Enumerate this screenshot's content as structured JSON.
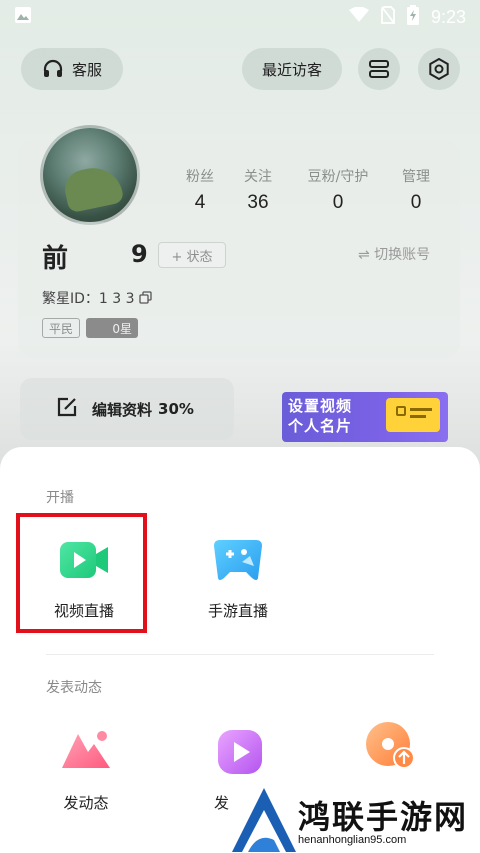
{
  "status_bar": {
    "time": "9:23"
  },
  "header": {
    "customer_service": "客服",
    "recent_visitors": "最近访客"
  },
  "profile": {
    "stats": [
      {
        "label": "粉丝",
        "value": "4"
      },
      {
        "label": "关注",
        "value": "36"
      },
      {
        "label": "豆粉/守护",
        "value": "0"
      },
      {
        "label": "管理",
        "value": "0"
      }
    ],
    "name": "前",
    "level_digit": "9",
    "state_button": "+ 状态",
    "switch_account": "⇌ 切换账号",
    "fanxing_id": "繁星ID：1  3  3 ",
    "badge_rank": "平民",
    "badge_star": "0星"
  },
  "edit_profile": {
    "label": "编辑资料",
    "percent": "30%"
  },
  "banner": {
    "line1": "设置视频",
    "line2": "个人名片"
  },
  "sheet": {
    "live_section": "开播",
    "live_actions": [
      {
        "label": "视频直播"
      },
      {
        "label": "手游直播"
      }
    ],
    "post_section": "发表动态",
    "post_actions": [
      {
        "label": "发动态"
      },
      {
        "label": "发"
      },
      {
        "label": ""
      }
    ]
  },
  "watermark": {
    "title": "鸿联手游网",
    "url": "henanhonglian95.com"
  },
  "colors": {
    "video_live_green": "#2fd98a",
    "game_live_blue": "#39b6f5",
    "highlight_red": "#e2101a"
  }
}
